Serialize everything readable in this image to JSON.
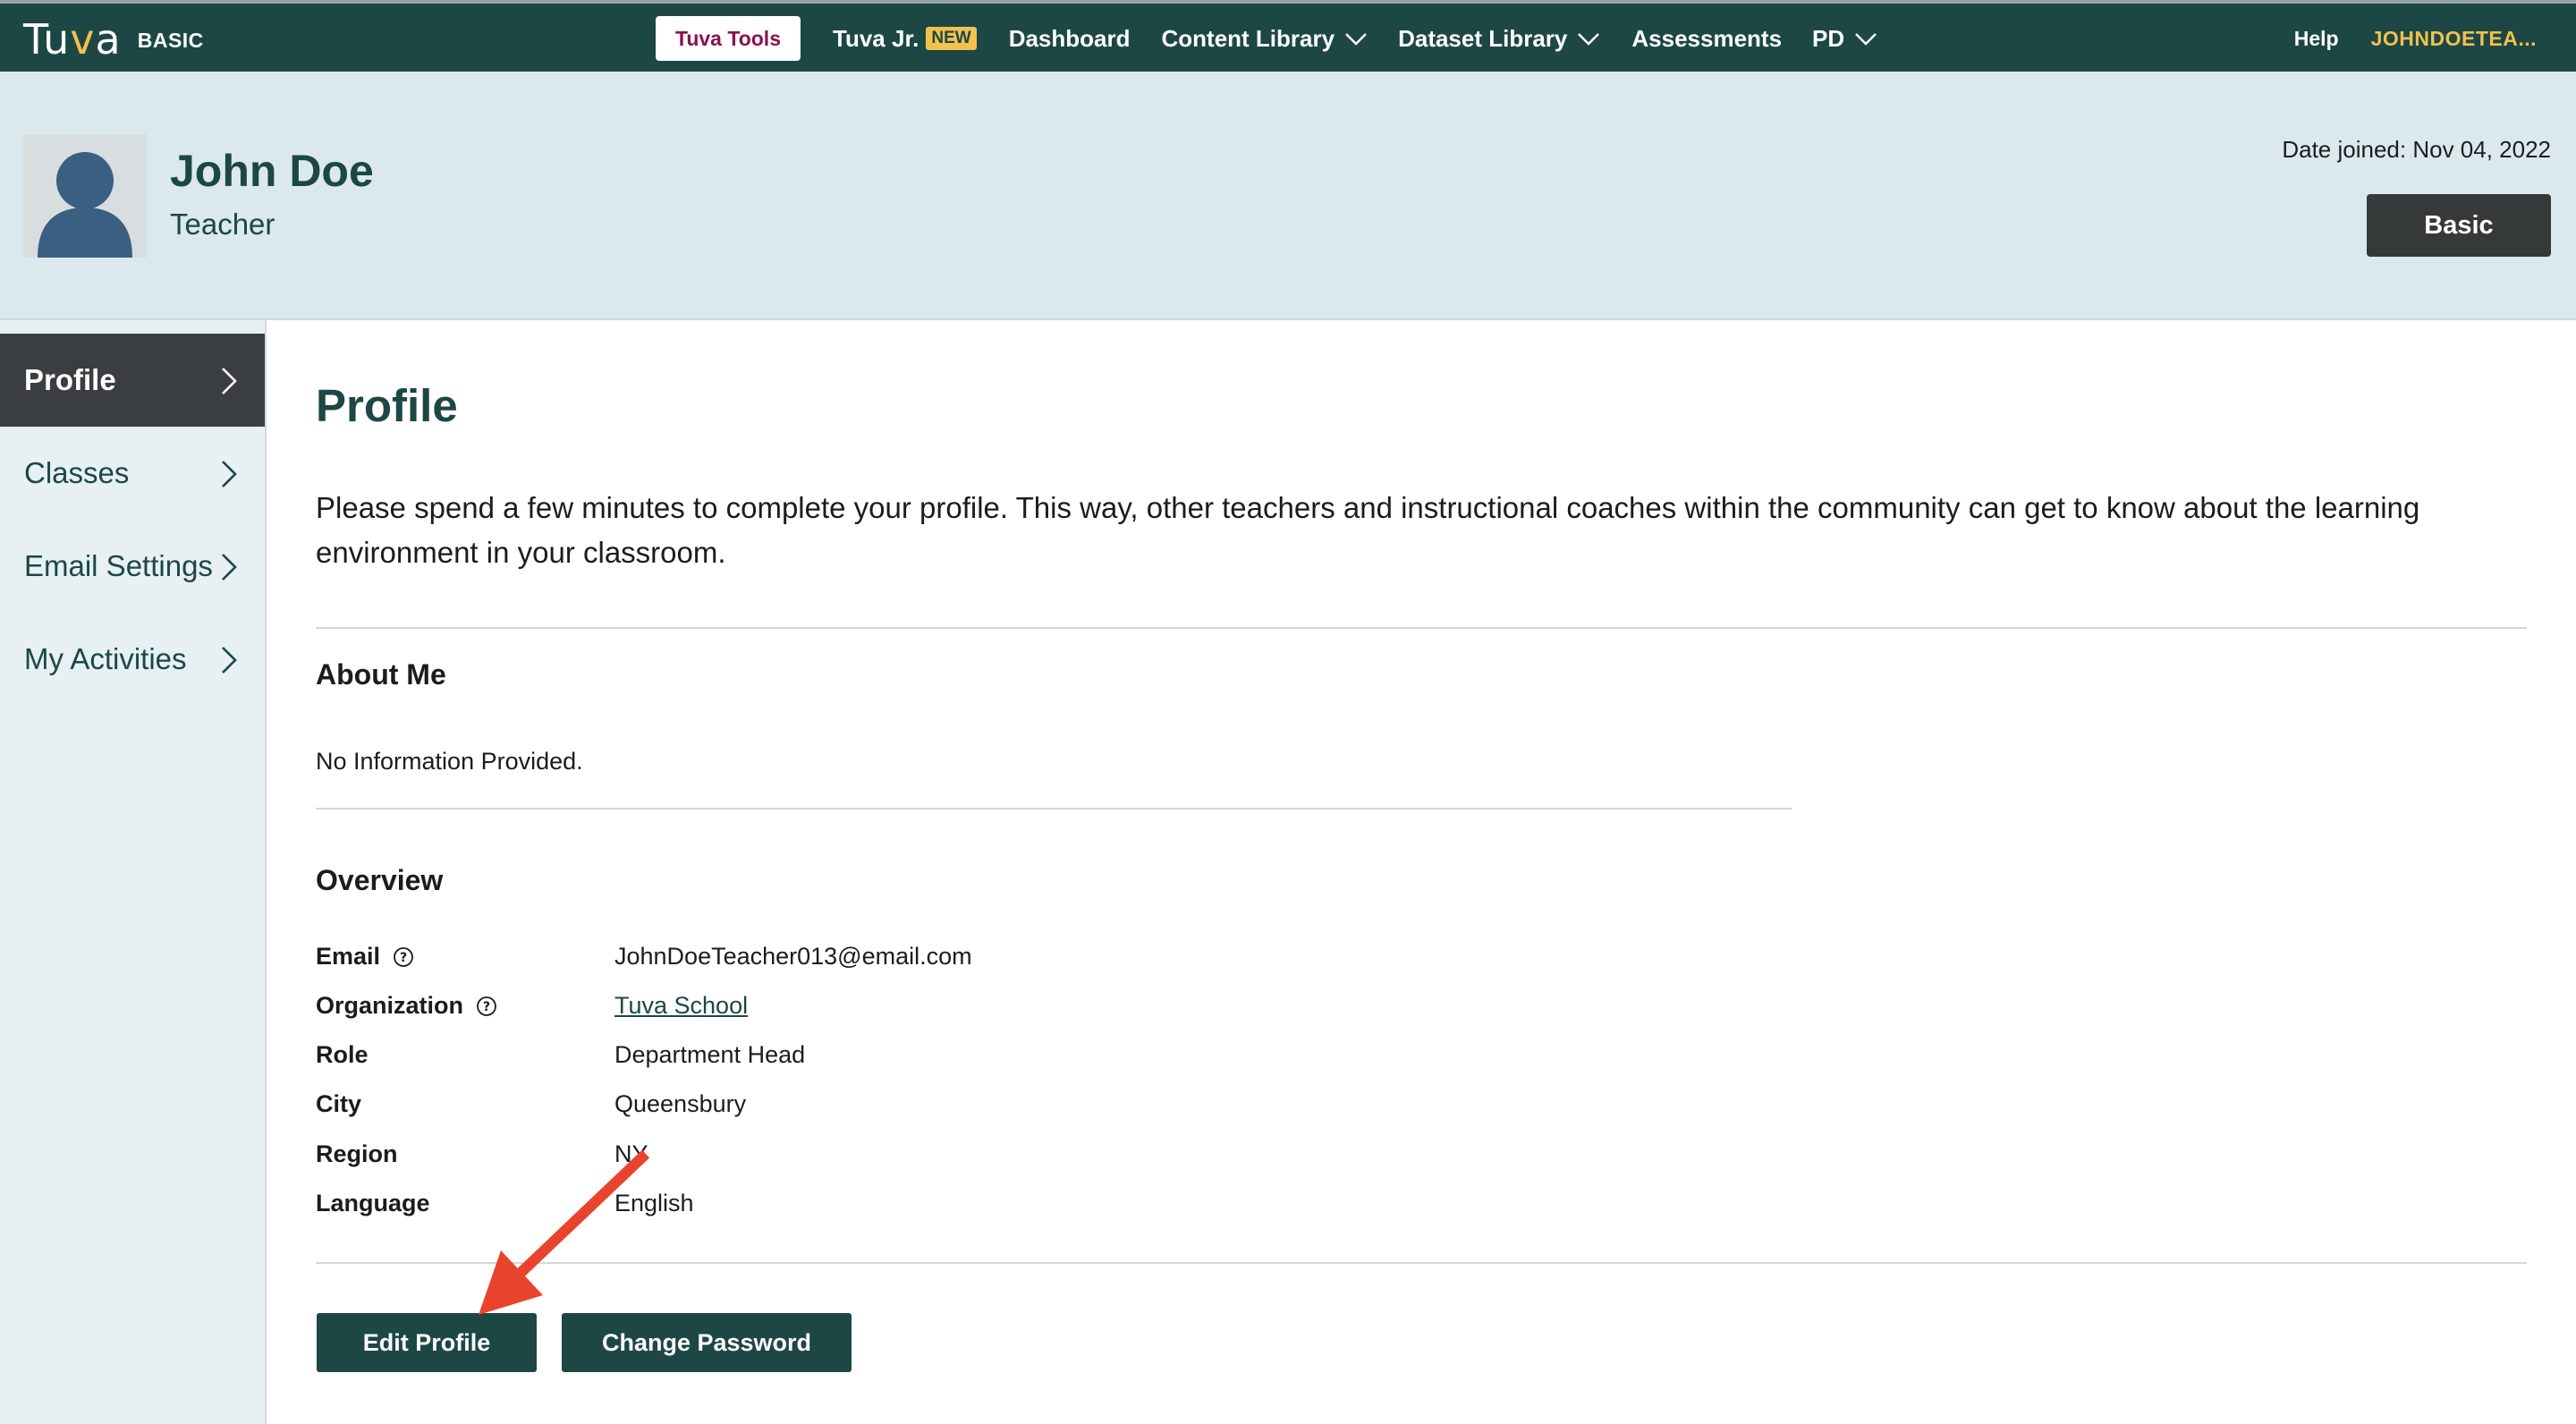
{
  "topnav": {
    "logo": {
      "text_part1": "Tu",
      "text_v": "v",
      "text_part2": "a",
      "plan_tag": "BASIC"
    },
    "tools_button": "Tuva Tools",
    "items": [
      {
        "label": "Tuva Jr.",
        "badge": "NEW"
      },
      {
        "label": "Dashboard"
      },
      {
        "label": "Content Library"
      },
      {
        "label": "Dataset Library"
      },
      {
        "label": "Assessments"
      },
      {
        "label": "PD"
      }
    ],
    "help": "Help",
    "user": "JOHNDOETEA..."
  },
  "header": {
    "name": "John Doe",
    "role": "Teacher",
    "date_joined": "Date joined: Nov 04, 2022",
    "plan_button": "Basic"
  },
  "sidebar": {
    "items": [
      {
        "label": "Profile",
        "active": true
      },
      {
        "label": "Classes"
      },
      {
        "label": "Email Settings"
      },
      {
        "label": "My Activities"
      }
    ]
  },
  "main": {
    "title": "Profile",
    "intro": "Please spend a few minutes to complete your profile. This way, other teachers and instructional coaches within the community can get to know about the learning environment in your classroom.",
    "about": {
      "heading": "About Me",
      "text": "No Information Provided."
    },
    "overview": {
      "heading": "Overview",
      "rows": [
        {
          "label": "Email",
          "value": "JohnDoeTeacher013@email.com"
        },
        {
          "label": "Organization",
          "value": "Tuva School"
        },
        {
          "label": "Role",
          "value": "Department Head"
        },
        {
          "label": "City",
          "value": "Queensbury"
        },
        {
          "label": "Region",
          "value": "NY"
        },
        {
          "label": "Language",
          "value": "English"
        }
      ]
    },
    "buttons": {
      "edit": "Edit Profile",
      "change_password": "Change Password"
    }
  },
  "colors": {
    "nav_bg": "#1c4745",
    "accent_yellow": "#f2c14e",
    "tools_text": "#8a1250",
    "header_bg": "#dbe9ee",
    "sidebar_bg": "#e7f0f3",
    "active_tab_bg": "#3a3e40",
    "annotation_arrow": "#e8432d"
  },
  "icons": {
    "nav_dropdown": "chevron-down-icon",
    "sidebar_arrow": "chevron-right-icon",
    "help_tooltip": "question-circle-icon",
    "avatar": "user-silhouette-icon",
    "annotation": "red-arrow-icon"
  }
}
